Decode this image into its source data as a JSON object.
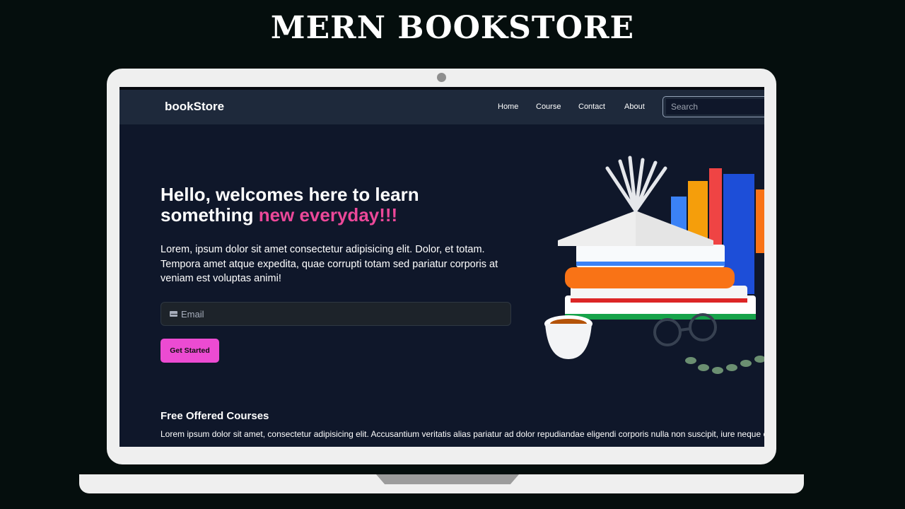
{
  "banner": {
    "title": "MERN BOOKSTORE"
  },
  "navbar": {
    "brand": "bookStore",
    "links": [
      {
        "label": "Home"
      },
      {
        "label": "Course"
      },
      {
        "label": "Contact"
      },
      {
        "label": "About"
      }
    ],
    "search": {
      "placeholder": "Search"
    }
  },
  "hero": {
    "title_part1": "Hello, welcomes here to learn something",
    "title_highlight": "new everyday!!!",
    "description": "Lorem, ipsum dolor sit amet consectetur adipisicing elit. Dolor, et totam. Tempora amet atque expedita, quae corrupti totam sed pariatur corporis at veniam est voluptas animi!",
    "email_placeholder": "Email",
    "cta_label": "Get Started",
    "illustration_icon": "book-stack-illustration"
  },
  "courses": {
    "title": "Free Offered Courses",
    "description": "Lorem ipsum dolor sit amet, consectetur adipisicing elit. Accusantium veritatis alias pariatur ad dolor repudiandae eligendi corporis nulla non suscipit, iure neque earum?"
  },
  "colors": {
    "background": "#050e0d",
    "screen_bg": "#0f172a",
    "navbar_bg": "#1e293b",
    "accent_pink": "#ec4899",
    "button_pink": "#ec4bd2"
  }
}
